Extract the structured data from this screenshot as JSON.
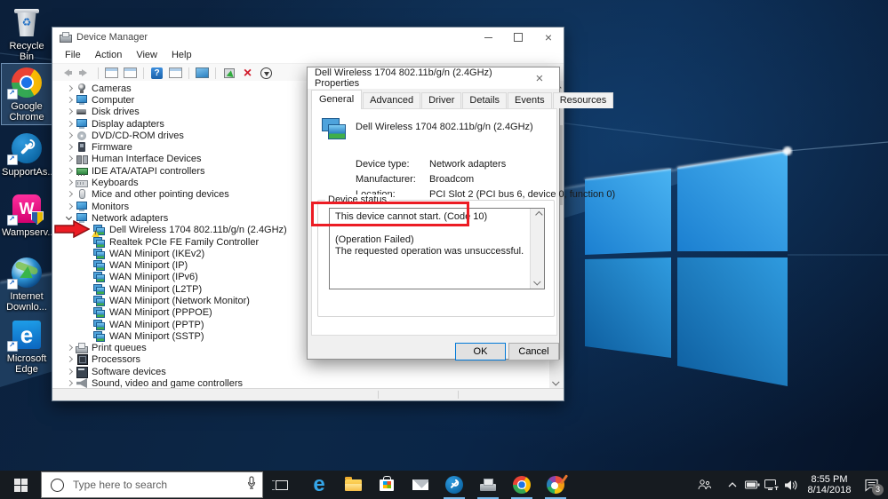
{
  "colors": {
    "accent": "#0078d7",
    "annotation_red": "#ec1c24",
    "taskbar_bg": "#161b20",
    "warning_yellow": "#f8d02c"
  },
  "desktop": {
    "icons": [
      {
        "label": "Recycle Bin",
        "icon": "recycle-bin-icon"
      },
      {
        "label": "Google Chrome",
        "icon": "google-chrome-icon",
        "selected": true
      },
      {
        "label": "SupportAs...",
        "icon": "supportassist-icon"
      },
      {
        "label": "Wampserv...",
        "icon": "wampserver-icon"
      },
      {
        "label": "Internet Downlo...",
        "icon": "internet-download-manager-icon"
      },
      {
        "label": "Microsoft Edge",
        "icon": "microsoft-edge-icon"
      }
    ]
  },
  "device_manager": {
    "title": "Device Manager",
    "menus": [
      "File",
      "Action",
      "View",
      "Help"
    ],
    "toolbar_icons": [
      "back",
      "forward",
      "show-console-tree",
      "properties",
      "help",
      "action-pane",
      "scan-hardware-changes",
      "update-driver",
      "uninstall-device",
      "disable-device"
    ],
    "tree": [
      {
        "label": "Cameras",
        "icon": "webcam-icon",
        "state": "collapsed"
      },
      {
        "label": "Computer",
        "icon": "computer-icon",
        "state": "collapsed"
      },
      {
        "label": "Disk drives",
        "icon": "disk-icon",
        "state": "collapsed"
      },
      {
        "label": "Display adapters",
        "icon": "display-adapter-icon",
        "state": "collapsed"
      },
      {
        "label": "DVD/CD-ROM drives",
        "icon": "cdrom-icon",
        "state": "collapsed"
      },
      {
        "label": "Firmware",
        "icon": "firmware-icon",
        "state": "collapsed"
      },
      {
        "label": "Human Interface Devices",
        "icon": "hid-icon",
        "state": "collapsed"
      },
      {
        "label": "IDE ATA/ATAPI controllers",
        "icon": "ide-controller-icon",
        "state": "collapsed"
      },
      {
        "label": "Keyboards",
        "icon": "keyboard-icon",
        "state": "collapsed"
      },
      {
        "label": "Mice and other pointing devices",
        "icon": "mouse-icon",
        "state": "collapsed"
      },
      {
        "label": "Monitors",
        "icon": "monitor-icon",
        "state": "collapsed"
      },
      {
        "label": "Network adapters",
        "icon": "network-category-icon",
        "state": "expanded"
      },
      {
        "label": "Dell Wireless 1704 802.11b/g/n (2.4GHz)",
        "icon": "network-adapter-icon",
        "warning": true,
        "level": 1
      },
      {
        "label": "Realtek PCIe FE Family Controller",
        "icon": "network-adapter-icon",
        "level": 1
      },
      {
        "label": "WAN Miniport (IKEv2)",
        "icon": "network-adapter-icon",
        "level": 1
      },
      {
        "label": "WAN Miniport (IP)",
        "icon": "network-adapter-icon",
        "level": 1
      },
      {
        "label": "WAN Miniport (IPv6)",
        "icon": "network-adapter-icon",
        "level": 1
      },
      {
        "label": "WAN Miniport (L2TP)",
        "icon": "network-adapter-icon",
        "level": 1
      },
      {
        "label": "WAN Miniport (Network Monitor)",
        "icon": "network-adapter-icon",
        "level": 1
      },
      {
        "label": "WAN Miniport (PPPOE)",
        "icon": "network-adapter-icon",
        "level": 1
      },
      {
        "label": "WAN Miniport (PPTP)",
        "icon": "network-adapter-icon",
        "level": 1
      },
      {
        "label": "WAN Miniport (SSTP)",
        "icon": "network-adapter-icon",
        "level": 1
      },
      {
        "label": "Print queues",
        "icon": "printer-icon",
        "state": "collapsed"
      },
      {
        "label": "Processors",
        "icon": "processor-icon",
        "state": "collapsed"
      },
      {
        "label": "Software devices",
        "icon": "software-device-icon",
        "state": "collapsed"
      },
      {
        "label": "Sound, video and game controllers",
        "icon": "sound-icon",
        "state": "collapsed"
      }
    ]
  },
  "properties_dialog": {
    "title": "Dell Wireless 1704 802.11b/g/n (2.4GHz) Properties",
    "tabs": [
      "General",
      "Advanced",
      "Driver",
      "Details",
      "Events",
      "Resources"
    ],
    "active_tab": "General",
    "device_name": "Dell Wireless 1704 802.11b/g/n (2.4GHz)",
    "fields": [
      {
        "label": "Device type:",
        "value": "Network adapters"
      },
      {
        "label": "Manufacturer:",
        "value": "Broadcom"
      },
      {
        "label": "Location:",
        "value": "PCI Slot 2 (PCI bus 6, device 0, function 0)"
      }
    ],
    "group_label": "Device status",
    "status_lines": [
      "This device cannot start. (Code 10)",
      "(Operation Failed)",
      "The requested operation was unsuccessful."
    ],
    "buttons": {
      "ok": "OK",
      "cancel": "Cancel"
    }
  },
  "taskbar": {
    "search_placeholder": "Type here to search",
    "pinned_icons": [
      "start",
      "task-view",
      "microsoft-edge",
      "file-explorer",
      "microsoft-store",
      "mail",
      "supportassist",
      "device-manager",
      "google-chrome",
      "paint-3d"
    ],
    "running_apps": [
      "supportassist",
      "device-manager",
      "google-chrome",
      "paint-3d"
    ],
    "tray": {
      "time": "8:55 PM",
      "date": "8/14/2018",
      "notification_count": "3"
    }
  }
}
